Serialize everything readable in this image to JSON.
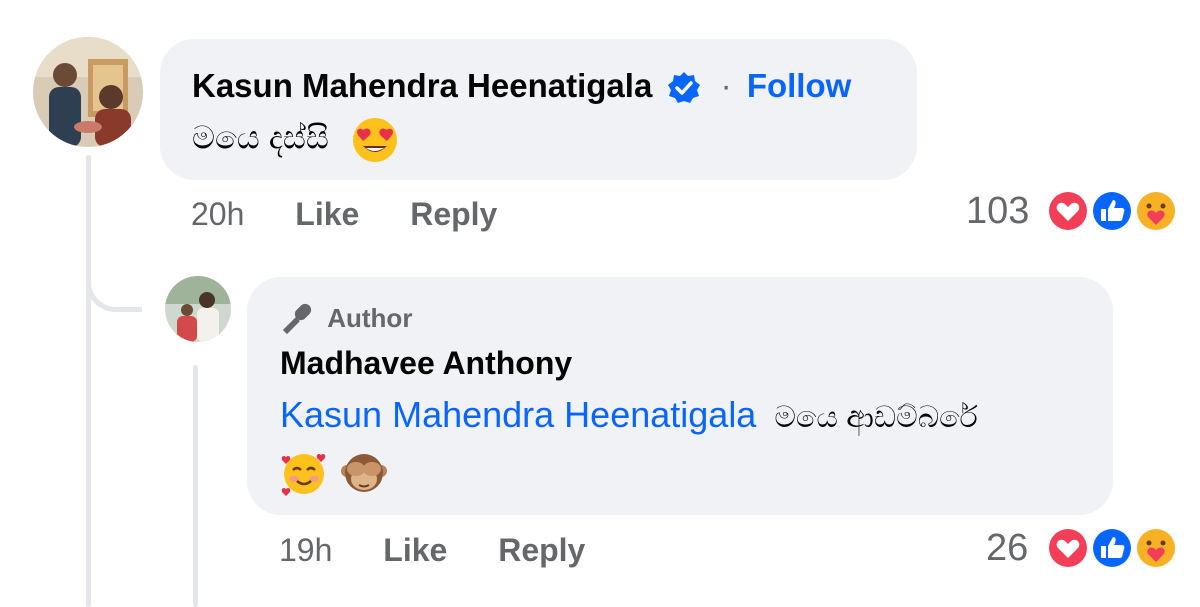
{
  "comment": {
    "author": "Kasun Mahendra Heenatigala",
    "separator": "·",
    "follow_label": "Follow",
    "text": "මයෙ දස්සි",
    "emoji": "heart-eyes-emoji",
    "time": "20h",
    "like_label": "Like",
    "reply_label": "Reply",
    "reaction_count": "103",
    "reactions": [
      "love",
      "like",
      "care"
    ]
  },
  "reply": {
    "badge_label": "Author",
    "author": "Madhavee Anthony",
    "mention": "Kasun Mahendra Heenatigala",
    "text": "මයෙ ආඩම්බරේ",
    "emojis": [
      "smiling-face-with-hearts-emoji",
      "see-no-evil-monkey-emoji"
    ],
    "time": "19h",
    "like_label": "Like",
    "reply_label": "Reply",
    "reaction_count": "26",
    "reactions": [
      "love",
      "like",
      "care"
    ]
  },
  "colors": {
    "link": "#0866ff",
    "bubble": "#f0f2f5",
    "meta": "#65676b",
    "love": "#f33e58",
    "like": "#0866ff"
  }
}
